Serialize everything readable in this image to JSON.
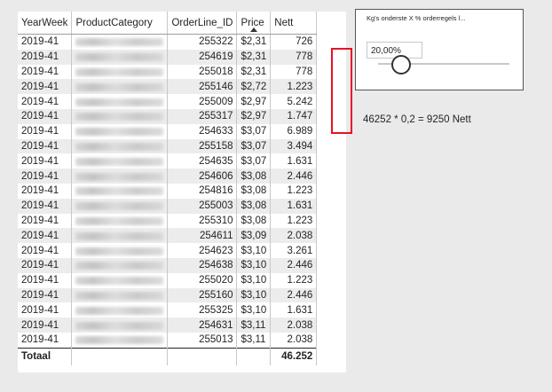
{
  "table": {
    "columns": [
      "YearWeek",
      "ProductCategory",
      "OrderLine_ID",
      "Price",
      "Nett"
    ],
    "rows": [
      [
        "2019-41",
        "",
        "255322",
        "$2,31",
        "726"
      ],
      [
        "2019-41",
        "",
        "254619",
        "$2,31",
        "778"
      ],
      [
        "2019-41",
        "",
        "255018",
        "$2,31",
        "778"
      ],
      [
        "2019-41",
        "",
        "255146",
        "$2,72",
        "1.223"
      ],
      [
        "2019-41",
        "",
        "255009",
        "$2,97",
        "5.242"
      ],
      [
        "2019-41",
        "",
        "255317",
        "$2,97",
        "1.747"
      ],
      [
        "2019-41",
        "",
        "254633",
        "$3,07",
        "6.989"
      ],
      [
        "2019-41",
        "",
        "255158",
        "$3,07",
        "3.494"
      ],
      [
        "2019-41",
        "",
        "254635",
        "$3,07",
        "1.631"
      ],
      [
        "2019-41",
        "",
        "254606",
        "$3,08",
        "2.446"
      ],
      [
        "2019-41",
        "",
        "254816",
        "$3,08",
        "1.223"
      ],
      [
        "2019-41",
        "",
        "255003",
        "$3,08",
        "1.631"
      ],
      [
        "2019-41",
        "",
        "255310",
        "$3,08",
        "1.223"
      ],
      [
        "2019-41",
        "",
        "254611",
        "$3,09",
        "2.038"
      ],
      [
        "2019-41",
        "",
        "254623",
        "$3,10",
        "3.261"
      ],
      [
        "2019-41",
        "",
        "254638",
        "$3,10",
        "2.446"
      ],
      [
        "2019-41",
        "",
        "255020",
        "$3,10",
        "1.223"
      ],
      [
        "2019-41",
        "",
        "255160",
        "$3,10",
        "2.446"
      ],
      [
        "2019-41",
        "",
        "255325",
        "$3,10",
        "1.631"
      ],
      [
        "2019-41",
        "",
        "254631",
        "$3,11",
        "2.038"
      ],
      [
        "2019-41",
        "",
        "255013",
        "$3,11",
        "2.038"
      ]
    ],
    "total": {
      "label": "Totaal",
      "nett": "46.252"
    },
    "sorted_column": "Price"
  },
  "slicer": {
    "title": "Kg's onderste X % orderregels l...",
    "value": "20,00%",
    "slider_fraction": 0.2
  },
  "formula_text": "46252 * 0,2 = 9250 Nett",
  "colors": {
    "highlight": "#e81123",
    "stripe": "#ececec"
  }
}
